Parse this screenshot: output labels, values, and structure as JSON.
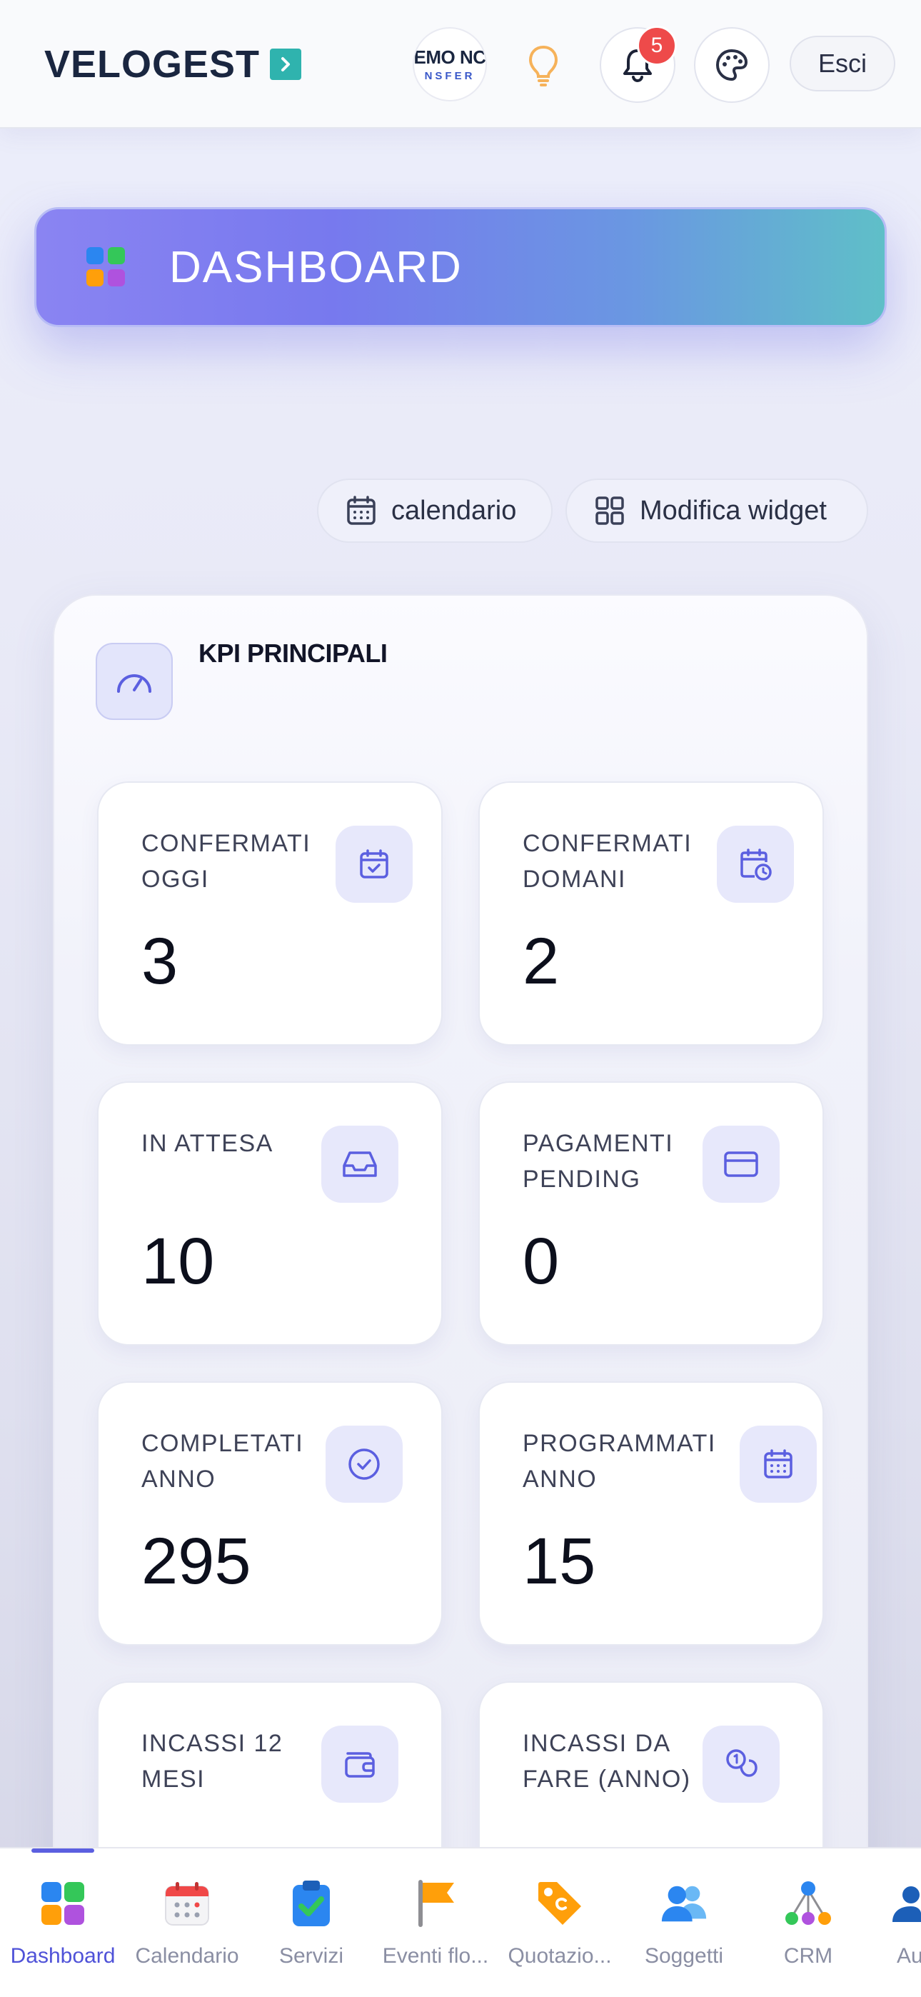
{
  "header": {
    "brand": "VELOGEST",
    "logo_line1": "EMO NC",
    "logo_line2": "NSFER",
    "notifications_count": "5",
    "logout_label": "Esci"
  },
  "banner": {
    "title": "DASHBOARD"
  },
  "actions": {
    "calendar_label": "calendario",
    "edit_widget_label": "Modifica widget"
  },
  "kpi": {
    "title": "KPI PRINCIPALI",
    "tiles": [
      {
        "label": "CONFERMATI OGGI",
        "value": "3",
        "icon": "calendar-check-icon"
      },
      {
        "label": "CONFERMATI DOMANI",
        "value": "2",
        "icon": "calendar-clock-icon"
      },
      {
        "label": "IN ATTESA",
        "value": "10",
        "icon": "inbox-icon"
      },
      {
        "label": "PAGAMENTI PENDING",
        "value": "0",
        "icon": "credit-card-icon"
      },
      {
        "label": "COMPLETATI ANNO",
        "value": "295",
        "icon": "check-circle-icon"
      },
      {
        "label": "PROGRAMMATI ANNO",
        "value": "15",
        "icon": "calendar-icon"
      },
      {
        "label": "INCASSI 12 MESI",
        "value": "",
        "icon": "wallet-icon"
      },
      {
        "label": "INCASSI DA FARE (ANNO)",
        "value": "",
        "icon": "coins-icon"
      }
    ]
  },
  "bottom_nav": {
    "items": [
      {
        "label": "Dashboard",
        "icon": "dashboard-grid-icon",
        "active": true
      },
      {
        "label": "Calendario",
        "icon": "calendar-icon"
      },
      {
        "label": "Servizi",
        "icon": "clipboard-check-icon"
      },
      {
        "label": "Eventi flo...",
        "icon": "flag-icon"
      },
      {
        "label": "Quotazio...",
        "icon": "price-tag-icon"
      },
      {
        "label": "Soggetti",
        "icon": "users-icon"
      },
      {
        "label": "CRM",
        "icon": "network-icon"
      },
      {
        "label": "Au",
        "icon": "user-icon"
      }
    ]
  },
  "colors": {
    "accent": "#5b5fe0",
    "brand_mark": "#2fb3ae",
    "badge": "#ee4a4a"
  }
}
